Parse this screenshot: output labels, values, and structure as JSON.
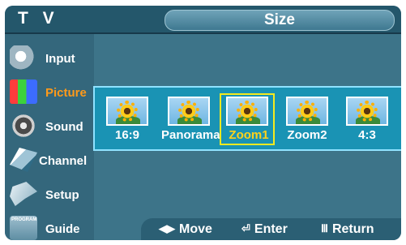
{
  "header": {
    "title": "T V",
    "section": "Size"
  },
  "sidebar": {
    "items": [
      {
        "label": "Input",
        "icon": "input-icon"
      },
      {
        "label": "Picture",
        "icon": "picture-icon"
      },
      {
        "label": "Sound",
        "icon": "sound-icon"
      },
      {
        "label": "Channel",
        "icon": "channel-icon"
      },
      {
        "label": "Setup",
        "icon": "setup-icon"
      },
      {
        "label": "Guide",
        "icon": "guide-icon"
      }
    ],
    "active": "Picture"
  },
  "size_options": [
    {
      "label": "16:9"
    },
    {
      "label": "Panorama"
    },
    {
      "label": "Zoom1"
    },
    {
      "label": "Zoom2"
    },
    {
      "label": "4:3"
    }
  ],
  "selected_size": "Zoom1",
  "footer": {
    "move_label": "Move",
    "enter_label": "Enter",
    "return_label": "Return"
  },
  "colors": {
    "background": "#3d7489",
    "panel": "#1a93b4",
    "active_text": "#ff9a1a",
    "selected_border": "#f6ea1e"
  }
}
